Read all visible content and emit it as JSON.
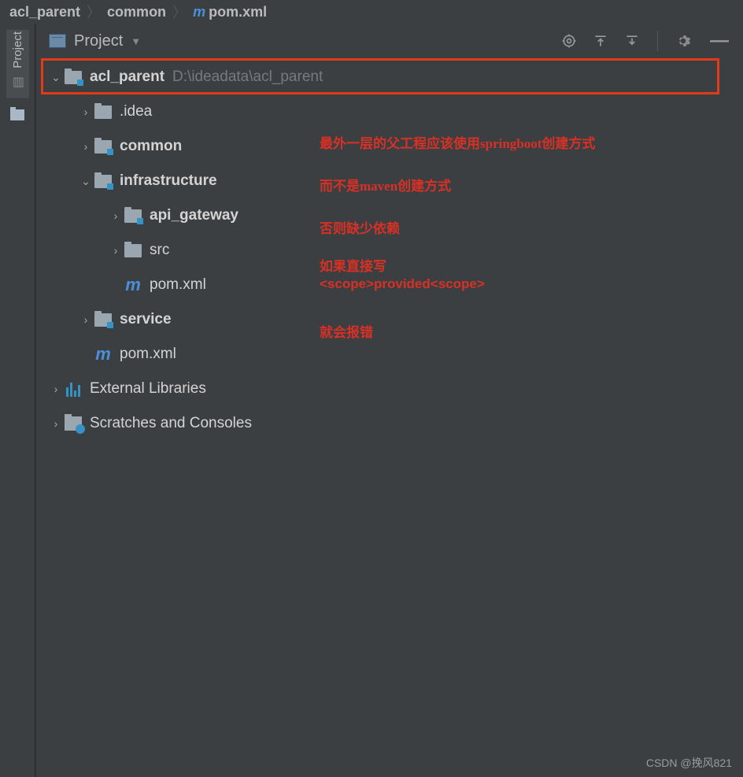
{
  "breadcrumb": {
    "parts": [
      "acl_parent",
      "common",
      "pom.xml"
    ]
  },
  "leftRail": {
    "tab": "Project"
  },
  "panel": {
    "title": "Project"
  },
  "tree": {
    "root": {
      "name": "acl_parent",
      "path": "D:\\ideadata\\acl_parent"
    },
    "idea": ".idea",
    "common": "common",
    "infrastructure": "infrastructure",
    "api_gateway": "api_gateway",
    "src": "src",
    "infra_pom": "pom.xml",
    "service": "service",
    "root_pom": "pom.xml",
    "external": "External Libraries",
    "scratches": "Scratches and Consoles"
  },
  "annotations": {
    "a1": "最外一层的父工程应该使用springboot创建方式",
    "a2": "而不是maven创建方式",
    "a3": "否则缺少依赖",
    "a4a": "如果直接写",
    "a4b": "<scope>provided<scope>",
    "a5": "就会报错"
  },
  "watermark": "CSDN @挽风821"
}
